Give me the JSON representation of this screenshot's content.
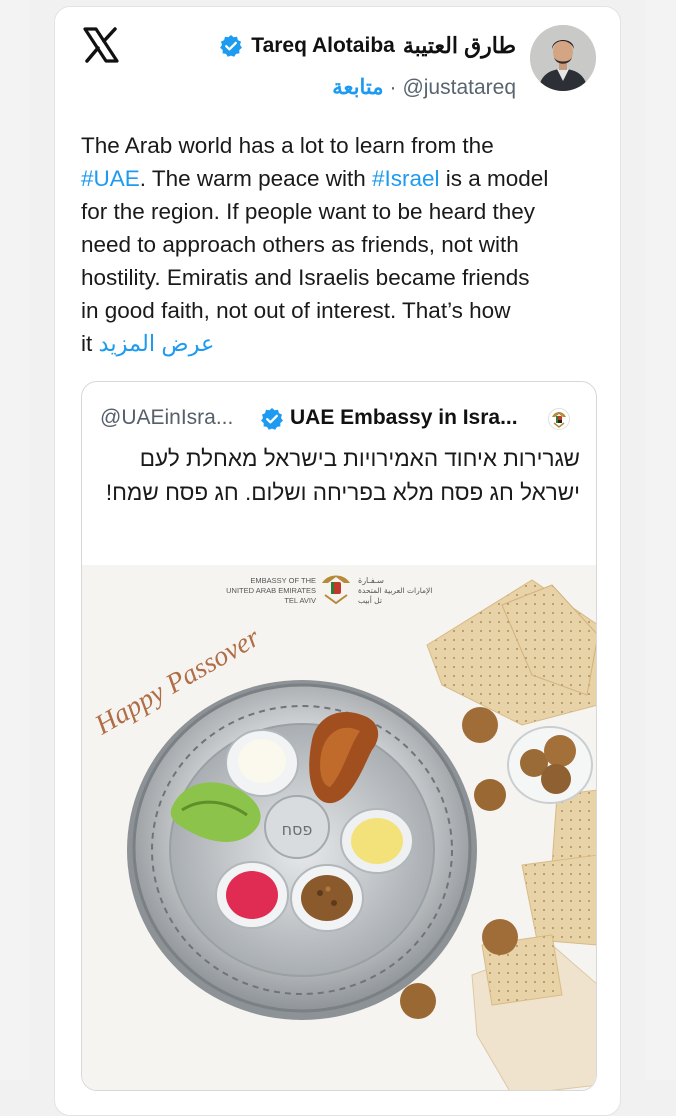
{
  "tweet": {
    "author_arabic": "طارق العتيبة",
    "author_name": "Tareq Alotaiba",
    "handle": "@justatareq",
    "separator": "·",
    "follow_label": "متابعة",
    "text_lines": {
      "p1": "The Arab world has a lot to learn from the",
      "p2a": "#UAE",
      "p2b": ". The warm peace with ",
      "p2c": "#Israel",
      "p2d": " is a model",
      "p3": "for the region. If people want to be heard they",
      "p4": "need to approach others as friends, not with",
      "p5": "hostility. Emiratis and Israelis became friends",
      "p6": "in good faith, not out of interest. That’s how",
      "p7a": "it ",
      "p7b": "عرض المزيد"
    }
  },
  "quote": {
    "handle": "@UAEinIsra...",
    "name": "UAE Embassy in Isra...",
    "text": "שגרירות איחוד האמירויות בישראל מאחלת לעם ישראל חג פסח מלא בפריחה ושלום. חג פסח שמח!",
    "media": {
      "greeting": "Happy Passover",
      "embassy_en_1": "EMBASSY OF THE",
      "embassy_en_2": "UNITED ARAB EMIRATES",
      "embassy_en_3": "TEL AVIV",
      "embassy_ar_1": "سـفـارة",
      "embassy_ar_2": "الإمارات العربية المتحدة",
      "embassy_ar_3": "تل أبيب",
      "plate_center_text": "פסח"
    }
  },
  "colors": {
    "accent": "#1d9bf0",
    "text": "#1a1a1a",
    "muted": "#586470"
  },
  "icons": {
    "logo": "x-logo-icon",
    "verified": "verified-badge-icon",
    "emblem": "uae-emblem-icon"
  }
}
